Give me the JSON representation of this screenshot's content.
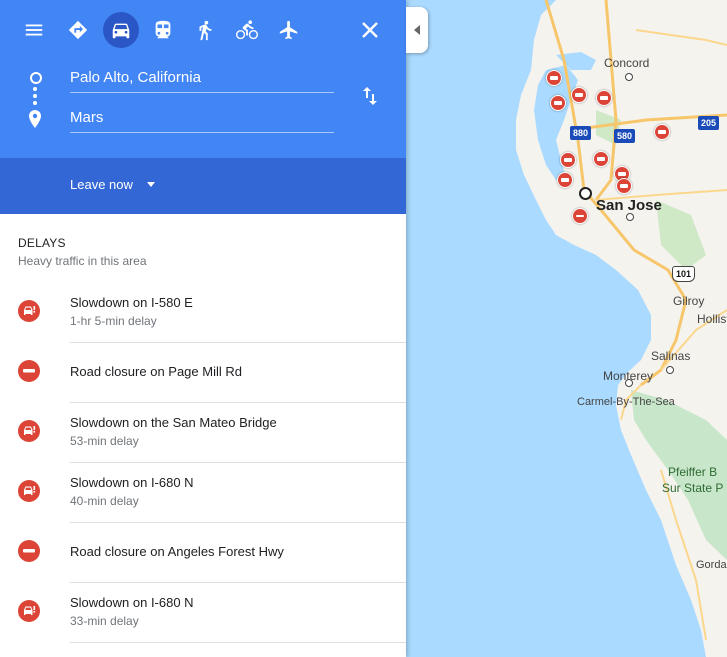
{
  "modes": {
    "menu_icon": "hamburger-menu-icon",
    "items": [
      {
        "name": "best-route",
        "icon": "directions-diamond-icon"
      },
      {
        "name": "driving",
        "icon": "car-icon",
        "active": true
      },
      {
        "name": "transit",
        "icon": "train-icon"
      },
      {
        "name": "walking",
        "icon": "walking-person-icon"
      },
      {
        "name": "cycling",
        "icon": "bicycle-icon"
      },
      {
        "name": "flights",
        "icon": "airplane-icon"
      }
    ],
    "close_icon": "close-icon"
  },
  "route": {
    "origin": "Palo Alto, California",
    "destination": "Mars",
    "swap_icon": "swap-vertical-icon"
  },
  "leave": {
    "label": "Leave now"
  },
  "delays": {
    "title": "DELAYS",
    "subtitle": "Heavy traffic in this area",
    "items": [
      {
        "type": "slowdown",
        "title": "Slowdown on I-580 E",
        "detail": "1-hr 5-min delay"
      },
      {
        "type": "closure",
        "title": "Road closure on Page Mill Rd",
        "detail": ""
      },
      {
        "type": "slowdown",
        "title": "Slowdown on the San Mateo Bridge",
        "detail": "53-min delay"
      },
      {
        "type": "slowdown",
        "title": "Slowdown on I-680 N",
        "detail": "40-min delay"
      },
      {
        "type": "closure",
        "title": "Road closure on Angeles Forest Hwy",
        "detail": ""
      },
      {
        "type": "slowdown",
        "title": "Slowdown on I-680 N",
        "detail": "33-min delay"
      }
    ]
  },
  "map": {
    "labels": {
      "concord": "Concord",
      "san_jose": "San Jose",
      "gilroy": "Gilroy",
      "hollister": "Hollist",
      "salinas": "Salinas",
      "monterey": "Monterey",
      "carmel": "Carmel-By-The-Sea",
      "pfeiffer1": "Pfeiffer B",
      "pfeiffer2": "Sur State P",
      "gorda": "Gorda"
    },
    "shields": {
      "i880": "880",
      "i580": "580",
      "i205": "205",
      "us101": "101"
    },
    "colors": {
      "water": "#aadaff",
      "land": "#f5f3ee",
      "park": "#c8e6c9",
      "incident": "#db4437",
      "header": "#4285f4"
    }
  }
}
